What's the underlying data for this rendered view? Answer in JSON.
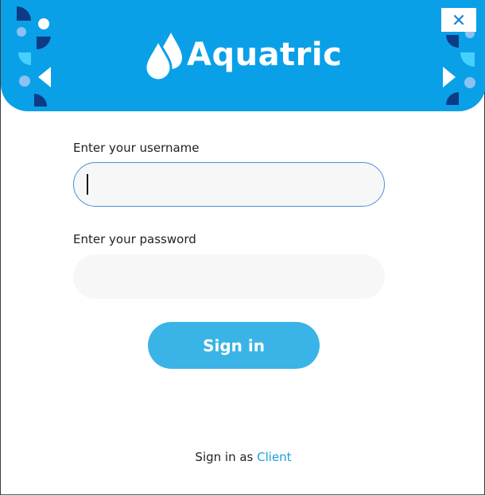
{
  "header": {
    "brand_name": "Aquatric",
    "close_label": "✕"
  },
  "form": {
    "username_label": "Enter your username",
    "username_value": "",
    "password_label": "Enter your password",
    "password_value": "",
    "submit_label": "Sign in"
  },
  "footer": {
    "prefix": "Sign in as",
    "link_label": "Client"
  },
  "colors": {
    "header_bg": "#0aa0e8",
    "button_bg": "#3ab4e6",
    "link": "#1aa0d8",
    "focus_border": "#4a90d9"
  },
  "icons": {
    "logo": "water-drops-icon",
    "close": "close-icon"
  }
}
